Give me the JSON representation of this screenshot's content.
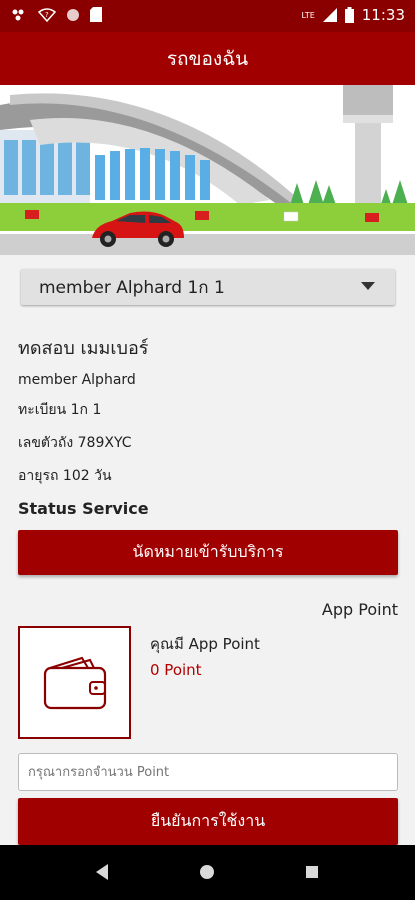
{
  "status_bar": {
    "time": "11:33",
    "network": "LTE"
  },
  "app_bar": {
    "title": "รถของฉัน"
  },
  "vehicle_select": {
    "value": "member Alphard 1ก 1"
  },
  "vehicle_info": {
    "owner_name": "ทดสอบ เมมเบอร์",
    "model": "member Alphard",
    "plate": "ทะเบียน 1ก 1",
    "chassis": "เลขตัวถัง 789XYC",
    "age": "อายุรถ 102 วัน"
  },
  "status_service": {
    "title": "Status Service",
    "appointment_button": "นัดหมายเข้ารับบริการ"
  },
  "app_point": {
    "title": "App Point",
    "have_label": "คุณมี App Point",
    "value": "0 Point",
    "input_placeholder": "กรุณากรอกจำนวน Point",
    "confirm_button": "ยืนยันการใช้งาน"
  },
  "icons": [
    "notification-icon",
    "wifi-icon",
    "circle-icon",
    "sd-card-icon",
    "signal-icon",
    "battery-icon",
    "wallet-icon",
    "back-icon",
    "home-icon",
    "recent-apps-icon"
  ],
  "colors": {
    "primary": "#a10000",
    "status_bar": "#8a0000",
    "accent_text": "#b00000"
  }
}
